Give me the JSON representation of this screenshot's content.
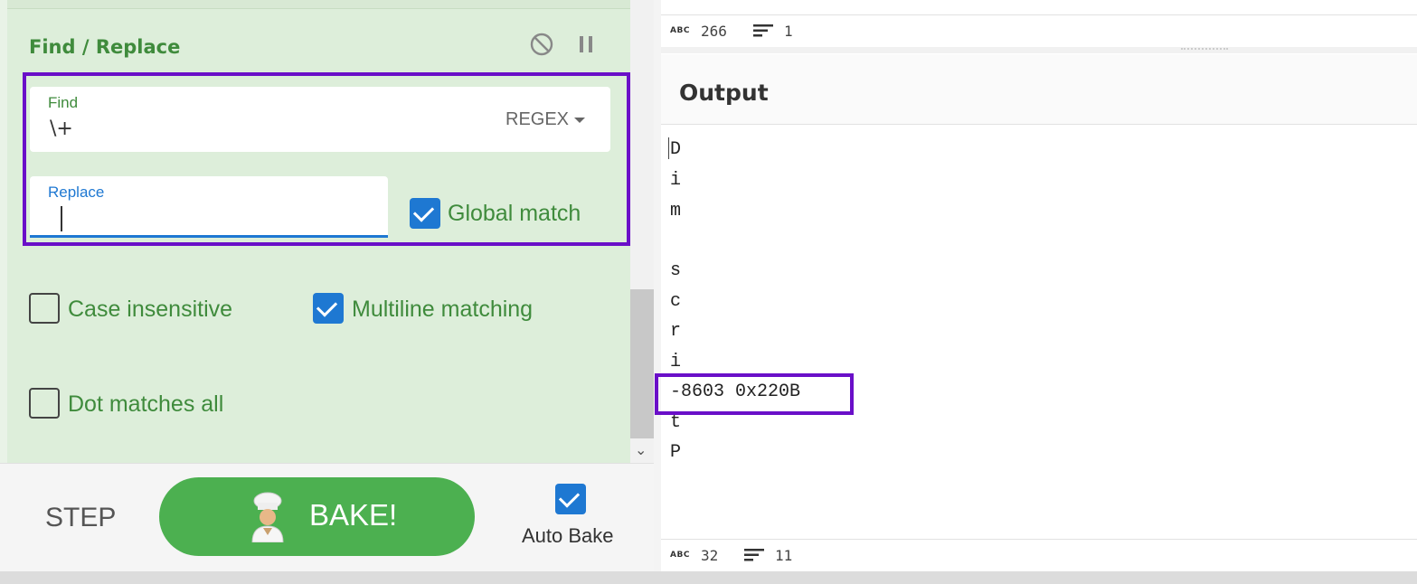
{
  "operation": {
    "title": "Find / Replace",
    "find": {
      "label": "Find",
      "value": "\\+",
      "mode": "REGEX"
    },
    "replace": {
      "label": "Replace",
      "value": ""
    },
    "global_match": {
      "label": "Global match",
      "checked": true
    },
    "case_insensitive": {
      "label": "Case insensitive",
      "checked": false
    },
    "multiline_matching": {
      "label": "Multiline matching",
      "checked": true
    },
    "dot_matches_all": {
      "label": "Dot matches all",
      "checked": false
    }
  },
  "controls": {
    "step_label": "STEP",
    "bake_label": "BAKE!",
    "auto_bake": {
      "label": "Auto Bake",
      "checked": true
    }
  },
  "input_stats": {
    "length": "266",
    "lines": "1"
  },
  "output": {
    "title": "Output",
    "lines": [
      "D",
      "i",
      "m",
      "",
      "s",
      "c",
      "r",
      "i",
      "-8603 0x220B",
      "t",
      "P"
    ],
    "stats": {
      "length": "32",
      "lines": "11"
    }
  },
  "colors": {
    "accent_green": "#3f8b3c",
    "panel_bg": "#ddeeda",
    "checkbox_blue": "#1e78d2",
    "bake_green": "#4cb050",
    "highlight_purple": "#6a0fc8"
  },
  "icons": [
    "disable-icon",
    "pause-icon",
    "chevron-down-icon",
    "chef-icon",
    "abc-icon",
    "lines-icon",
    "checkmark-icon"
  ]
}
